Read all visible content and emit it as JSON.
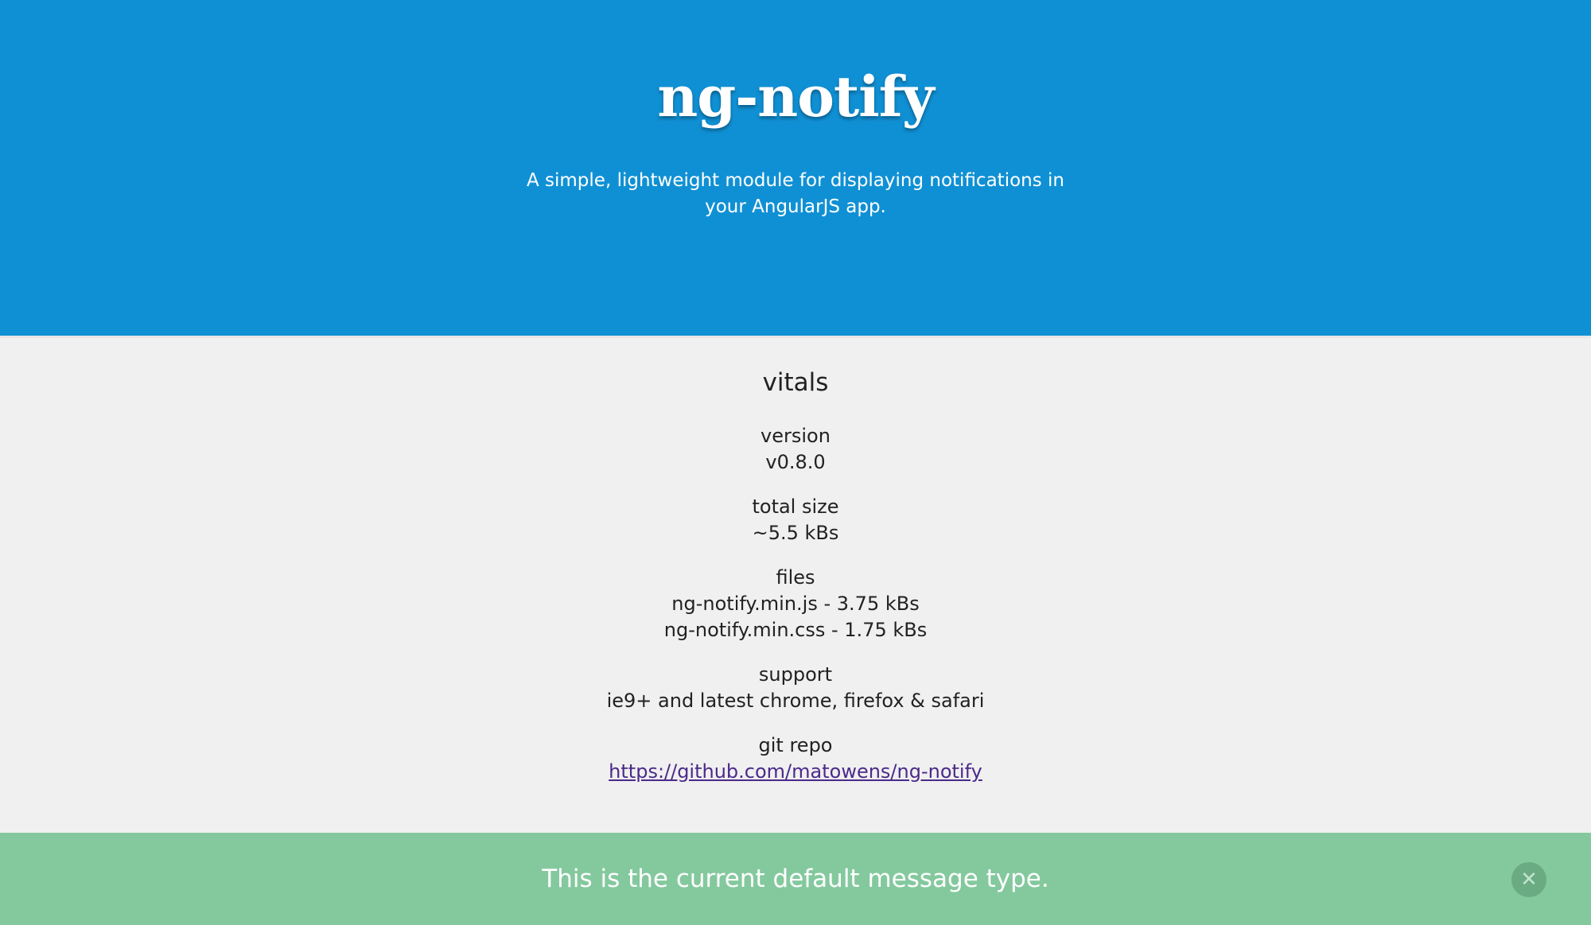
{
  "hero": {
    "title": "ng-notify",
    "subtitle": "A simple, lightweight module for displaying notifications in your AngularJS app."
  },
  "vitals": {
    "heading": "vitals",
    "version": {
      "label": "version",
      "value": "v0.8.0"
    },
    "total_size": {
      "label": "total size",
      "value": "~5.5 kBs"
    },
    "files": {
      "label": "files",
      "items": [
        "ng-notify.min.js - 3.75 kBs",
        "ng-notify.min.css - 1.75 kBs"
      ]
    },
    "support": {
      "label": "support",
      "value": "ie9+ and latest chrome, firefox & safari"
    },
    "git_repo": {
      "label": "git repo",
      "link": "https://github.com/matowens/ng-notify"
    }
  },
  "notification": {
    "message": "This is the current default message type.",
    "close_icon": "close-icon"
  },
  "colors": {
    "hero_bg": "#1090d4",
    "page_bg": "#f0f0f0",
    "toast_bg": "#84c99e",
    "link": "#4b2a8a"
  }
}
